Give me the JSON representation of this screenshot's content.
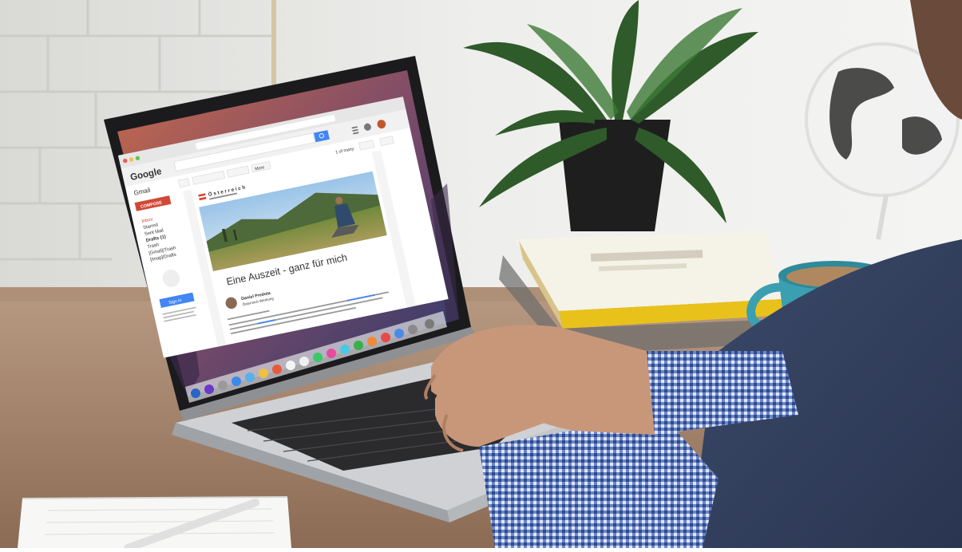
{
  "image": {
    "description_visible_only": true
  },
  "gmail": {
    "google_logo": "Google",
    "gmail_label": "Gmail",
    "compose": "COMPOSE",
    "folders": [
      "Inbox",
      "Starred",
      "Sent Mail",
      "Drafts (1)",
      "Trash",
      "[Gmail]/Trash",
      "[Imap]/Drafts"
    ],
    "sign_in": "Sign in",
    "more_button": "More",
    "pager": "1 of many"
  },
  "email": {
    "brand_name": "Österreich",
    "headline": "Eine Auszeit - ganz für mich",
    "sender_name": "Daniel Predota",
    "sender_org": "Österreich Werbung"
  },
  "colors": {
    "gmail_red": "#d14836",
    "google_blue": "#4285f4",
    "mug": "#3a9fb0",
    "book_yellow": "#e8c21a"
  }
}
